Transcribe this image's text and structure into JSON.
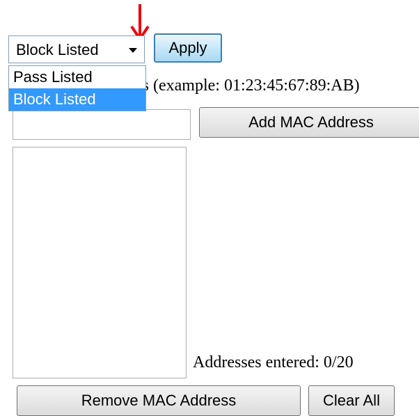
{
  "filter_select": {
    "selected_value": "Block Listed",
    "options": [
      "Pass Listed",
      "Block Listed"
    ],
    "highlighted_option": "Block Listed"
  },
  "apply_button": {
    "label": "Apply"
  },
  "mac_entry": {
    "label": "Enter MAC Address (example: 01:23:45:67:89:AB)",
    "input_value": "",
    "add_button_label": "Add MAC Address"
  },
  "address_list": {
    "items": [],
    "count_text": "Addresses entered: 0/20"
  },
  "actions": {
    "remove_label": "Remove MAC Address",
    "clear_label": "Clear All"
  },
  "annotation": {
    "arrow_color": "#e8000b",
    "icon": "down-arrow-icon"
  },
  "colors": {
    "highlight": "#3399ff",
    "apply_border": "#3c7fb1"
  }
}
